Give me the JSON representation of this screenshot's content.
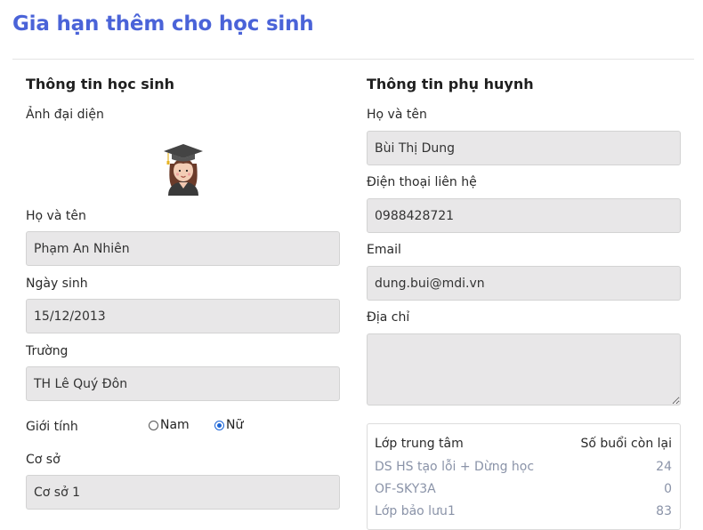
{
  "page": {
    "title": "Gia hạn thêm cho học sinh"
  },
  "student": {
    "section_title": "Thông tin học sinh",
    "avatar_label": "Ảnh đại diện",
    "name_label": "Họ và tên",
    "name_value": "Phạm An Nhiên",
    "dob_label": "Ngày sinh",
    "dob_value": "15/12/2013",
    "school_label": "Trường",
    "school_value": "TH Lê Quý Đôn",
    "gender_label": "Giới tính",
    "gender_options": [
      "Nam",
      "Nữ"
    ],
    "gender_selected": "Nữ",
    "campus_label": "Cơ sở",
    "campus_value": "Cơ sở 1"
  },
  "parent": {
    "section_title": "Thông tin phụ huynh",
    "name_label": "Họ và tên",
    "name_value": "Bùi Thị Dung",
    "phone_label": "Điện thoại liên hệ",
    "phone_value": "0988428721",
    "email_label": "Email",
    "email_value": "dung.bui@mdi.vn",
    "address_label": "Địa chỉ",
    "address_value": ""
  },
  "classes": {
    "col_class": "Lớp trung tâm",
    "col_sessions": "Số buổi còn lại",
    "rows": [
      {
        "name": "DS HS tạo lỗi + Dừng học",
        "sessions": "24"
      },
      {
        "name": "OF-SKY3A",
        "sessions": "0"
      },
      {
        "name": "Lớp bảo lưu1",
        "sessions": "83"
      }
    ]
  },
  "icons": {
    "avatar": "graduate-girl-icon"
  },
  "colors": {
    "title": "#4a63d8",
    "field_bg": "#e8e7e8",
    "muted_text": "#8a93a8",
    "radio_checked": "#1b64d6"
  }
}
